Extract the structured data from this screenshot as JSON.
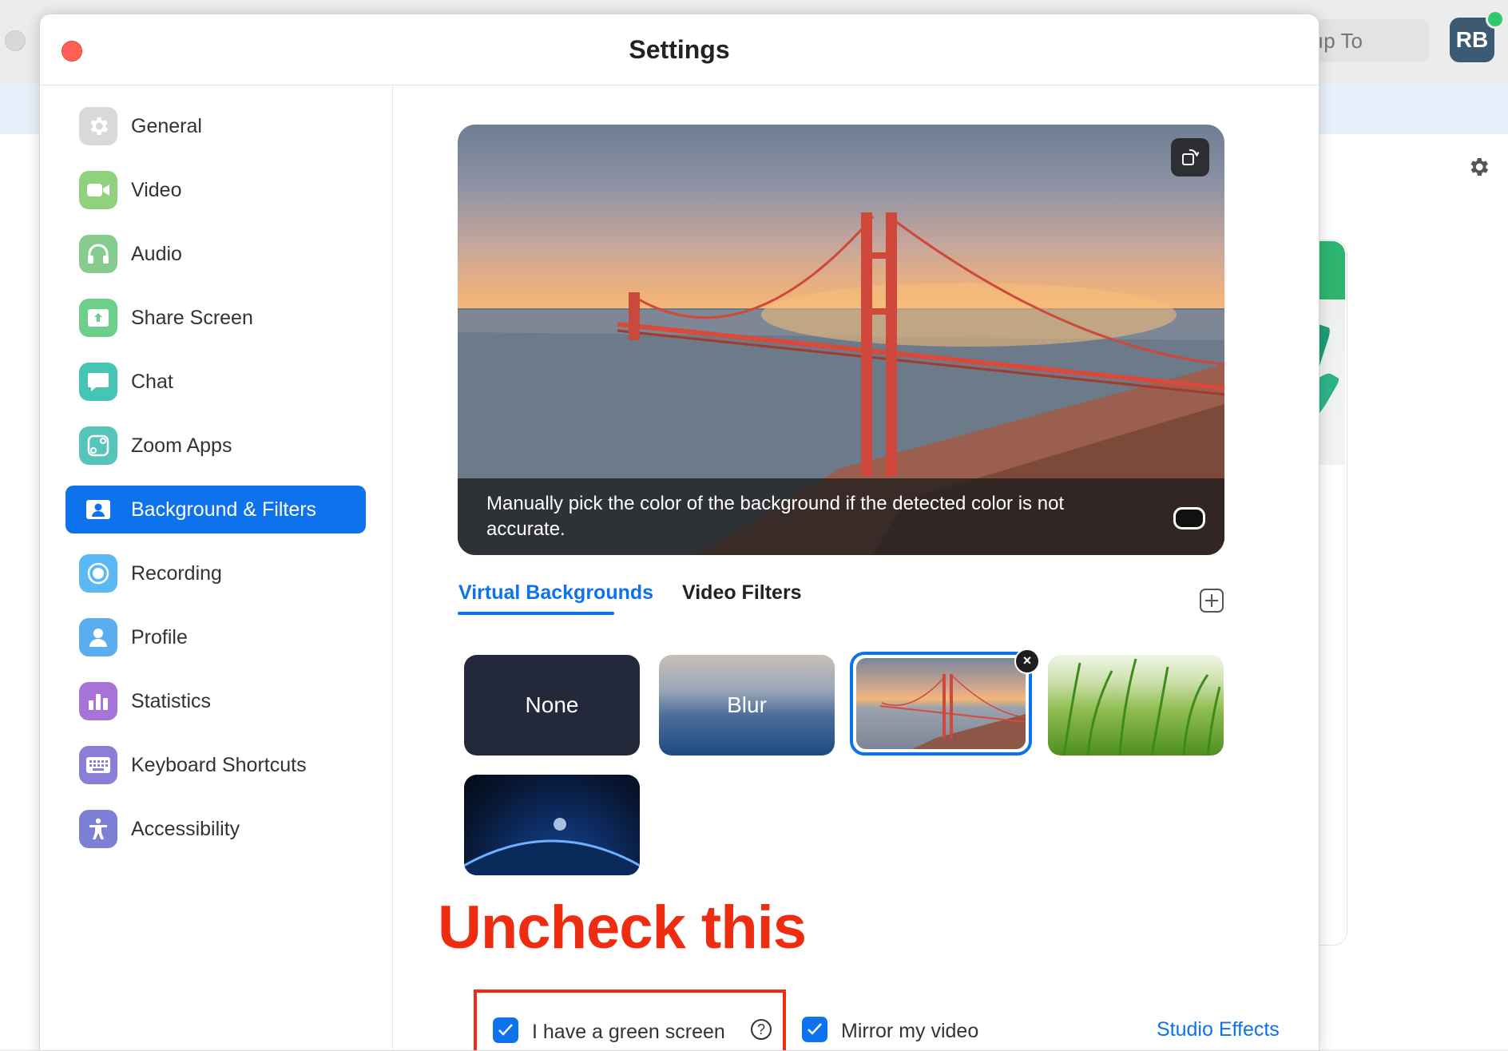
{
  "background_app": {
    "jump_to_label": "ıp To",
    "avatar_initials": "RB"
  },
  "dialog": {
    "title": "Settings"
  },
  "sidebar": {
    "items": [
      {
        "label": "General",
        "icon": "gear-icon",
        "color": "#d9d9d9"
      },
      {
        "label": "Video",
        "icon": "video-camera-icon",
        "color": "#8fd17c"
      },
      {
        "label": "Audio",
        "icon": "headphones-icon",
        "color": "#86cc8f"
      },
      {
        "label": "Share Screen",
        "icon": "share-screen-icon",
        "color": "#6ccf8a"
      },
      {
        "label": "Chat",
        "icon": "chat-bubble-icon",
        "color": "#45c6b4"
      },
      {
        "label": "Zoom Apps",
        "icon": "apps-icon",
        "color": "#56c5b9"
      },
      {
        "label": "Background & Filters",
        "icon": "person-card-icon",
        "color": "#0e72ed",
        "active": true
      },
      {
        "label": "Recording",
        "icon": "record-icon",
        "color": "#5ab8f2"
      },
      {
        "label": "Profile",
        "icon": "person-icon",
        "color": "#5aaef0"
      },
      {
        "label": "Statistics",
        "icon": "bar-chart-icon",
        "color": "#a873d9"
      },
      {
        "label": "Keyboard Shortcuts",
        "icon": "keyboard-icon",
        "color": "#8a7fd8"
      },
      {
        "label": "Accessibility",
        "icon": "accessibility-icon",
        "color": "#7c7fd6"
      }
    ]
  },
  "preview": {
    "caption": "Manually pick the color of the background if the detected color is not accurate.",
    "rotate_icon": "rotate-icon"
  },
  "tabs": {
    "virtual_backgrounds": "Virtual Backgrounds",
    "video_filters": "Video Filters"
  },
  "thumbnails": {
    "none_label": "None",
    "blur_label": "Blur",
    "remove_label": "×"
  },
  "annotation": {
    "text": "Uncheck this"
  },
  "options": {
    "green_screen_label": "I have a green screen",
    "green_screen_checked": true,
    "help_label": "?",
    "mirror_label": "Mirror my video",
    "mirror_checked": true,
    "studio_effects_label": "Studio Effects"
  },
  "colors": {
    "accent": "#0e72ed",
    "annotation_red": "#ee2c12"
  }
}
